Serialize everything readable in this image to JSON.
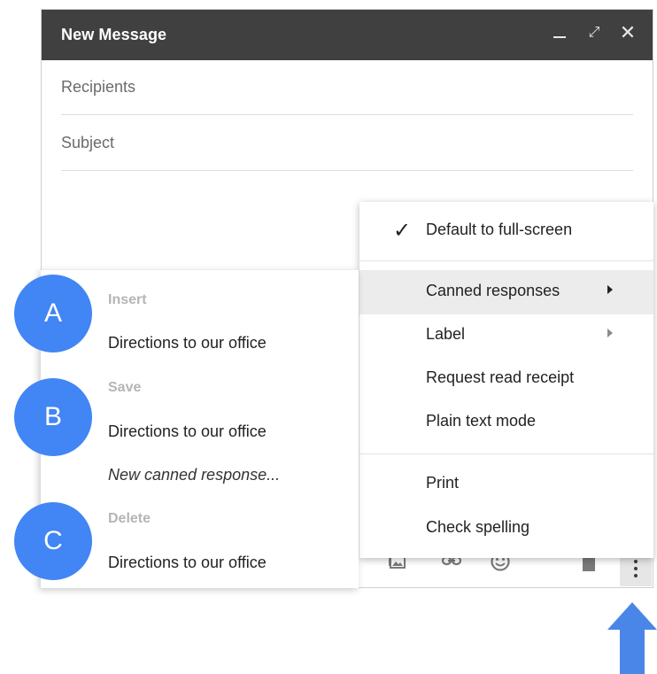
{
  "compose": {
    "title": "New Message",
    "recipients_placeholder": "Recipients",
    "subject_placeholder": "Subject"
  },
  "window_controls": [
    "minimize-icon",
    "expand-icon",
    "close-icon"
  ],
  "toolbar_icons": [
    "insert-photo-icon",
    "link-icon",
    "emoji-icon",
    "trash-icon",
    "more-vertical-icon"
  ],
  "more_menu": {
    "items": [
      {
        "label": "Default to full-screen",
        "checked": true
      },
      {
        "label": "Canned responses",
        "submenu": true,
        "highlighted": true
      },
      {
        "label": "Label",
        "submenu": true
      },
      {
        "label": "Request read receipt"
      },
      {
        "label": "Plain text mode"
      },
      {
        "label": "Print"
      },
      {
        "label": "Check spelling"
      }
    ]
  },
  "canned_submenu": {
    "insert_header": "Insert",
    "insert_item": "Directions to our office",
    "save_header": "Save",
    "save_item": "Directions to our office",
    "new_item": "New canned response...",
    "delete_header": "Delete",
    "delete_item": "Directions to our office"
  },
  "badges": [
    "A",
    "B",
    "C"
  ],
  "colors": {
    "accent": "#4285f4",
    "titlebar": "#404040"
  }
}
